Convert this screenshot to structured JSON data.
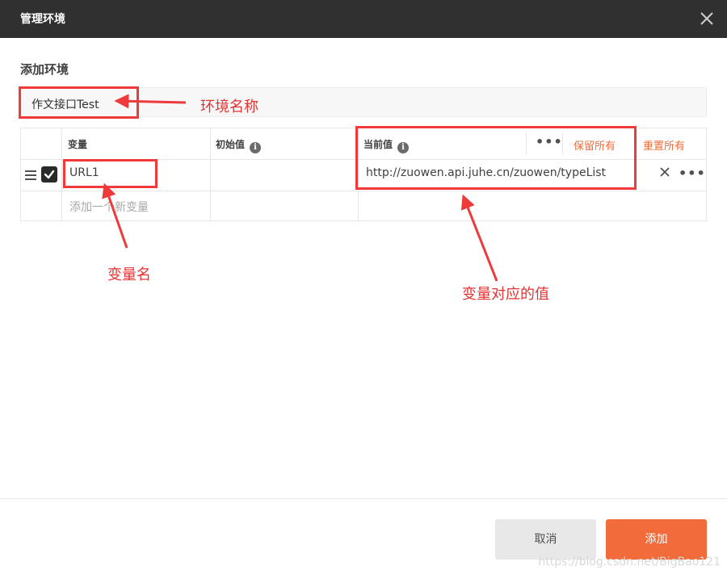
{
  "window": {
    "title": "管理环境",
    "close_icon": "close-icon"
  },
  "section_title": "添加环境",
  "env_name": {
    "value": "作文接口Test"
  },
  "table": {
    "headers": {
      "variable": "变量",
      "initial": "初始值",
      "current": "当前值",
      "persist_all": "保留所有",
      "reset_all": "重置所有"
    },
    "rows": [
      {
        "enabled": true,
        "variable": "URL1",
        "initial": "",
        "current": "http://zuowen.api.juhe.cn/zuowen/typeList"
      }
    ],
    "new_row_placeholder": "添加一个新变量"
  },
  "annotations": {
    "env_name": "环境名称",
    "variable_name": "变量名",
    "variable_value": "变量对应的值",
    "color": "#e53333"
  },
  "footer": {
    "cancel_label": "取消",
    "add_label": "添加"
  },
  "watermark": "https://blog.csdn.net/BigBao121",
  "colors": {
    "accent": "#f26b3a",
    "titlebar": "#303030"
  }
}
